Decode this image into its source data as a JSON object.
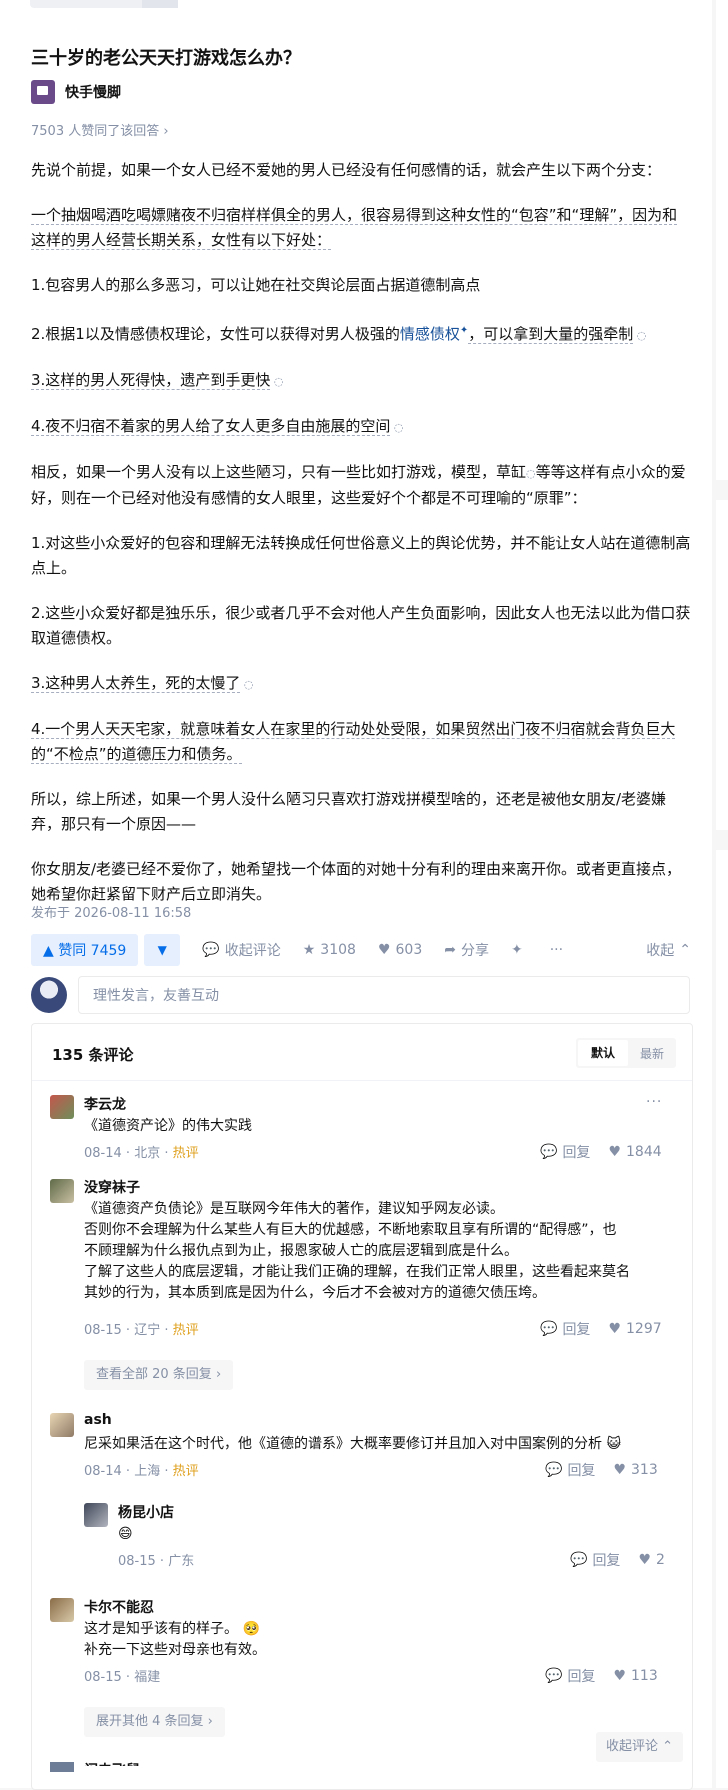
{
  "question": {
    "title": "三十岁的老公天天打游戏怎么办？"
  },
  "author": {
    "name": "快手慢脚"
  },
  "likes_meta": "7503 人赞同了该回答 ›",
  "paragraphs": {
    "p1": "先说个前提，如果一个女人已经不爱她的男人已经没有任何感情的话，就会产生以下两个分支：",
    "p2": "一个抽烟喝酒吃喝嫖赌夜不归宿样样俱全的男人，很容易得到这种女性的“包容”和“理解”，因为和这样的男人经营长期关系，女性有以下好处：",
    "p3": "1.包容男人的那么多恶习，可以让她在社交舆论层面占据道德制高点",
    "p4a": "2.根据1以及情感债权理论，女性可以获得对男人极强的",
    "p4b": "情感债权",
    "p4c": "，可以拿到大量的强牵制",
    "p5": "3.这样的男人死得快，遗产到手更快",
    "p6": "4.夜不归宿不着家的男人给了女人更多自由施展的空间",
    "p7": "相反，如果一个男人没有以上这些陋习，只有一些比如打游戏，模型，草缸",
    "p7b": "等等这样有点小众的爱好，则在一个已经对他没有感情的女人眼里，这些爱好个个都是不可理喻的“原罪”：",
    "p8": "1.对这些小众爱好的包容和理解无法转换成任何世俗意义上的舆论优势，并不能让女人站在道德制高点上。",
    "p9": "2.这些小众爱好都是独乐乐，很少或者几乎不会对他人产生负面影响，因此女人也无法以此为借口获取道德债权。",
    "p10": "3.这种男人太养生，死的太慢了",
    "p11": "4.一个男人天天宅家，就意味着女人在家里的行动处处受限，如果贸然出门夜不归宿就会背负巨大的“不检点”的道德压力和债务。",
    "p12": "所以，综上所述，如果一个男人没什么陋习只喜欢打游戏拼模型啥的，还老是被他女朋友/老婆嫌弃，那只有一个原因——",
    "p13": "你女朋友/老婆已经不爱你了，她希望找一个体面的对她十分有利的理由来离开你。或者更直接点，她希望你赶紧留下财产后立即消失。"
  },
  "published": "发布于 2026-08-11 16:58",
  "actions": {
    "upvote": "▲ 赞同 7459",
    "downvote": "▼",
    "comment": "收起评论",
    "favorite": "3108",
    "like": "603",
    "share": "分享",
    "collapse": "收起"
  },
  "input_placeholder": "理性发言，友善互动",
  "comments_header": {
    "count": "135 条评论",
    "sort_default": "默认",
    "sort_newest": "最新"
  },
  "comments": [
    {
      "name": "李云龙",
      "text": "《道德资产论》的伟大实践",
      "date": "08-14",
      "loc": "北京",
      "hot": "热评",
      "reply": "回复",
      "likes": "1844"
    },
    {
      "name": "没穿袜子",
      "l1": "《道德资产负债论》是互联网今年伟大的著作，建议知乎网友必读。",
      "l2": "否则你不会理解为什么某些人有巨大的优越感，不断地索取且享有所谓的“配得感”，也",
      "l3": "不顾理解为什么报仇点到为止，报恩家破人亡的底层逻辑到底是什么。",
      "l4": "了解了这些人的底层逻辑，才能让我们正确的理解，在我们正常人眼里，这些看起来莫名",
      "l5": "其妙的行为，其本质到底是因为什么，今后才不会被对方的道德欠债压垮。",
      "date": "08-15",
      "loc": "辽宁",
      "hot": "热评",
      "reply": "回复",
      "likes": "1297",
      "more": "查看全部 20 条回复 ›"
    },
    {
      "name": "ash",
      "text": "尼采如果活在这个时代，他《道德的谱系》大概率要修订并且加入对中国案例的分析",
      "date": "08-14",
      "loc": "上海",
      "hot": "热评",
      "reply": "回复",
      "likes": "313"
    },
    {
      "name": "杨昆小店",
      "text": "😄",
      "date": "08-15",
      "loc": "广东",
      "reply": "回复",
      "likes": "2"
    },
    {
      "name": "卡尔不能忍",
      "l1": "这才是知乎该有的样子。",
      "l2": "补充一下这些对母亲也有效。",
      "date": "08-15",
      "loc": "福建",
      "reply": "回复",
      "likes": "113",
      "more": "展开其他 4 条回复 ›"
    }
  ],
  "float_collapse": "收起评论 ⌃",
  "cut_name": "闪电飞鼠"
}
